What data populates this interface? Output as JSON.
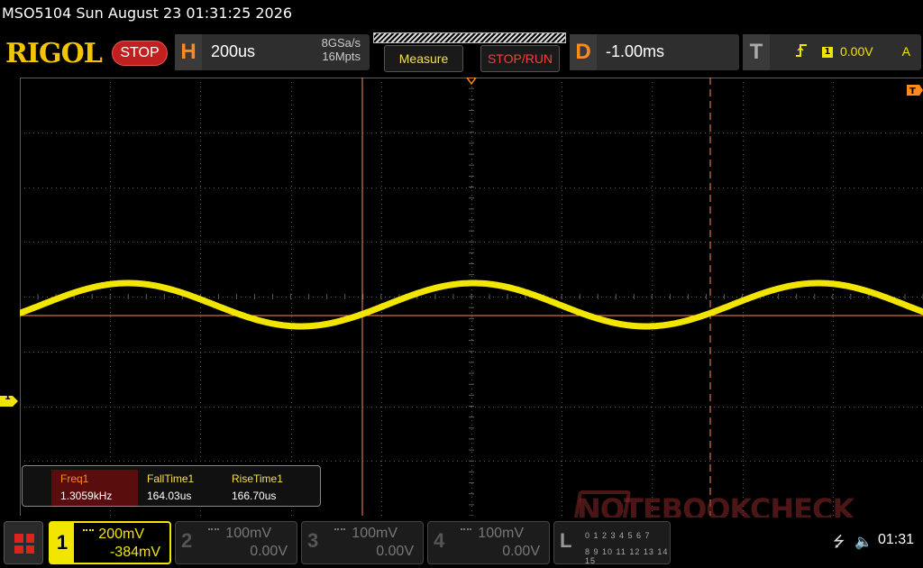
{
  "title_bar": {
    "text": "MSO5104  Sun August 23 01:31:25 2026"
  },
  "toolbar": {
    "logo": "RIGOL",
    "run_state": "STOP",
    "horizontal": {
      "letter": "H",
      "timebase": "200us",
      "sample_rate": "8GSa/s",
      "memory_depth": "16Mpts"
    },
    "measure_button": "Measure",
    "stop_run_button": "STOP/RUN",
    "delay": {
      "letter": "D",
      "value": "-1.00ms"
    },
    "trigger": {
      "letter": "T",
      "channel": "1",
      "level": "0.00V",
      "mode": "A",
      "edge_icon": "rising-edge-icon"
    }
  },
  "display": {
    "trace_color": "#f2e600",
    "cursor_color": "#ff8a5c",
    "grid_color": "#5a5a5a",
    "marker_trigger": "T",
    "marker_channel": "1"
  },
  "measurements": [
    {
      "label": "Freq1",
      "value": "1.3059kHz",
      "selected": true
    },
    {
      "label": "FallTime1",
      "value": "164.03us",
      "selected": false
    },
    {
      "label": "RiseTime1",
      "value": "166.70us",
      "selected": false
    }
  ],
  "watermark": "NOTEBOOKCHECK",
  "channels": [
    {
      "num": "1",
      "scale": "200mV",
      "offset": "-384mV",
      "active": true
    },
    {
      "num": "2",
      "scale": "100mV",
      "offset": "0.00V",
      "active": false
    },
    {
      "num": "3",
      "scale": "100mV",
      "offset": "0.00V",
      "active": false
    },
    {
      "num": "4",
      "scale": "100mV",
      "offset": "0.00V",
      "active": false
    }
  ],
  "logic_analyzer": {
    "letter": "L",
    "row1": "0 1 2 3 4 5 6 7",
    "row2": "8 9 10 11 12 13 14 15"
  },
  "status": {
    "usb_icon": "usb-icon",
    "speaker_icon": "speaker-muted-icon",
    "time": "01:31"
  }
}
